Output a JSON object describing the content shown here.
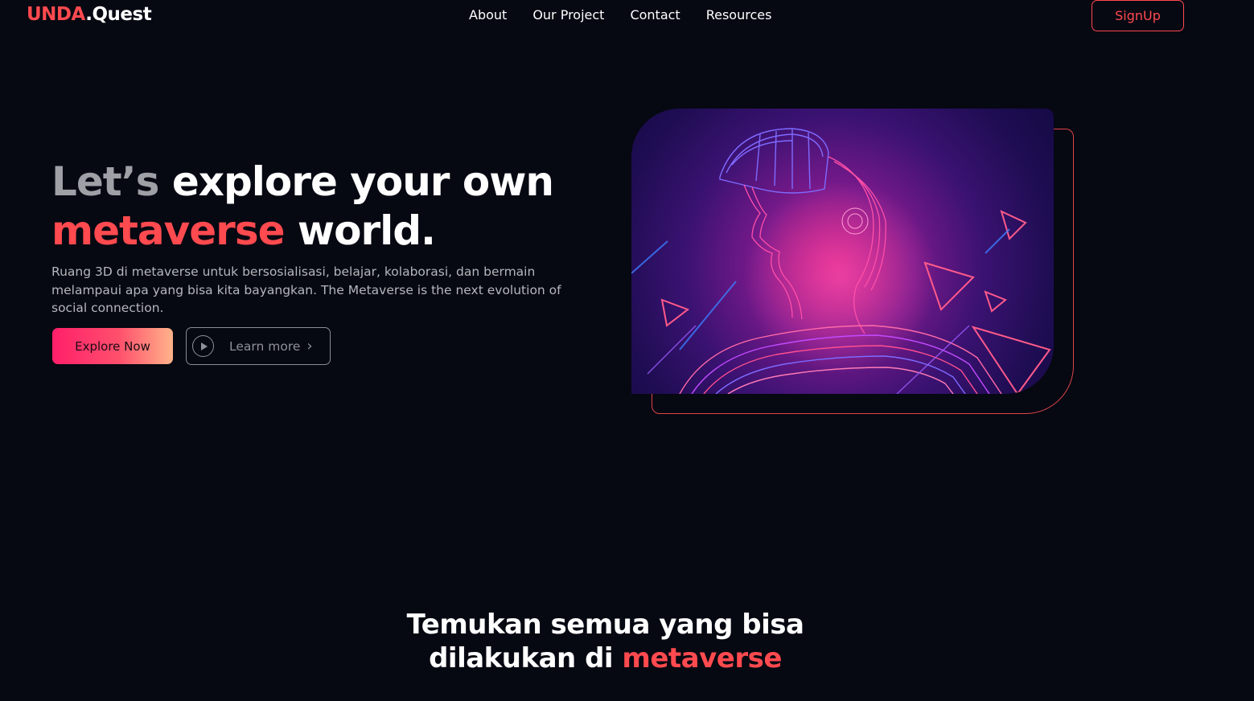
{
  "nav": {
    "logo_brand": "UNDA",
    "logo_rest": ".Quest",
    "links": [
      {
        "label": "About"
      },
      {
        "label": "Our Project"
      },
      {
        "label": "Contact"
      },
      {
        "label": "Resources"
      }
    ],
    "signup_label": "SignUp"
  },
  "hero": {
    "title_muted": "Let’s",
    "title_part1": " explore your own",
    "title_accent": "metaverse",
    "title_part2": " world.",
    "description": "Ruang 3D di metaverse untuk bersosialisasi, belajar, kolaborasi, dan bermain melampaui apa yang bisa kita bayangkan. The Metaverse is the next evolution of social connection.",
    "explore_label": "Explore Now",
    "learn_label": "Learn more",
    "image_icon": "vr-headset-person-illustration"
  },
  "section": {
    "title_line1": "Temukan semua yang bisa",
    "title_line2_prefix": "dilakukan di ",
    "title_line2_accent": "metaverse"
  },
  "colors": {
    "background": "#060812",
    "accent": "#ff4a4f",
    "muted_text": "#9ea0a6"
  }
}
